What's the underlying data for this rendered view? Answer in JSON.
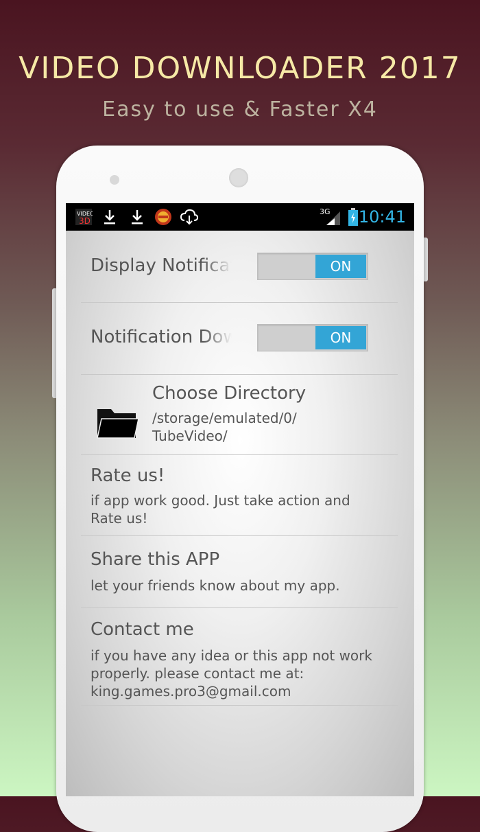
{
  "promo": {
    "headline": "VIDEO DOWNLOADER 2017",
    "subhead": "Easy to use & Faster X4"
  },
  "status_bar": {
    "time": "10:41",
    "network": "3G",
    "icons": [
      "app-logo-icon",
      "download-icon",
      "download-icon",
      "badge-icon",
      "cloud-download-icon",
      "signal-icon",
      "battery-icon"
    ],
    "time_color": "#33b5e5"
  },
  "settings": {
    "display_notification": {
      "label": "Display Notification",
      "toggle": "ON"
    },
    "notification_download": {
      "label": "Notification Download",
      "toggle": "ON"
    },
    "choose_directory": {
      "title": "Choose Directory",
      "path_line1": "/storage/emulated/0/",
      "path_line2": "TubeVideo/"
    },
    "rate_us": {
      "title": "Rate us!",
      "desc": "if app work good. Just take action and Rate us!"
    },
    "share_app": {
      "title": "Share this APP",
      "desc": "let your friends know about my app."
    },
    "contact_me": {
      "title": "Contact me",
      "desc": "if you have any idea or this app not work properly. please contact me at: king.games.pro3@gmail.com"
    }
  },
  "colors": {
    "accent": "#33a5d6",
    "headline": "#f6e9a6"
  }
}
